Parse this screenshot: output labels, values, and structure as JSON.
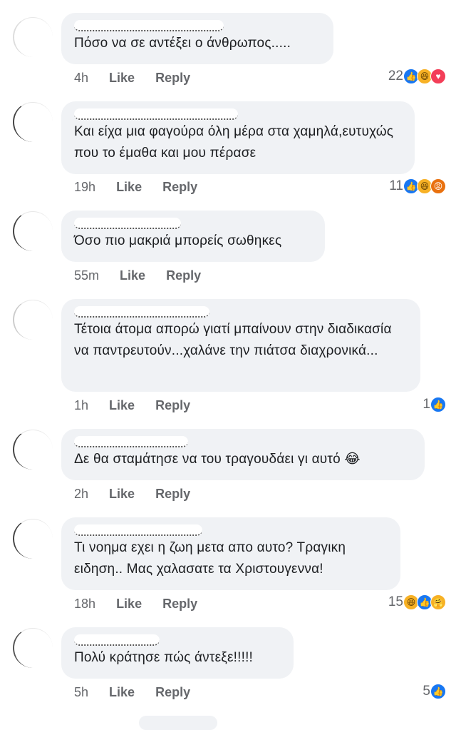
{
  "comments": [
    {
      "text": "Πόσο να σε αντέξει ο άνθρωπος.....",
      "time": "4h",
      "like": "Like",
      "reply": "Reply",
      "count": "22",
      "reactions": [
        "like",
        "haha",
        "love"
      ]
    },
    {
      "text": "Και είχα μια φαγούρα όλη μέρα στα χαμηλά,ευτυχώς που το έμαθα και μου πέρασε",
      "time": "19h",
      "like": "Like",
      "reply": "Reply",
      "count": "11",
      "reactions": [
        "like",
        "haha",
        "angry"
      ]
    },
    {
      "text": "Όσο πιο μακριά μπορείς σωθηκες",
      "time": "55m",
      "like": "Like",
      "reply": "Reply",
      "count": "",
      "reactions": []
    },
    {
      "text": "Τέτοια άτομα απορώ γιατί μπαίνουν στην διαδικασία να παντρευτούν...χαλάνε την πιάτσα διαχρονικά...",
      "time": "1h",
      "like": "Like",
      "reply": "Reply",
      "count": "1",
      "reactions": [
        "like"
      ]
    },
    {
      "text": "Δε θα σταμάτησε να του τραγουδάει γι αυτό 😂",
      "time": "2h",
      "like": "Like",
      "reply": "Reply",
      "count": "",
      "reactions": []
    },
    {
      "text": "Τι νοημα εχει η ζωη μετα απο αυτο? Τραγικη ειδηση.. Μας χαλασατε τα Χριστουγεννα!",
      "time": "18h",
      "like": "Like",
      "reply": "Reply",
      "count": "15",
      "reactions": [
        "haha",
        "like",
        "care"
      ]
    },
    {
      "text": "Πολύ κράτησε πώς άντεξε!!!!!",
      "time": "5h",
      "like": "Like",
      "reply": "Reply",
      "count": "5",
      "reactions": [
        "like"
      ]
    }
  ]
}
